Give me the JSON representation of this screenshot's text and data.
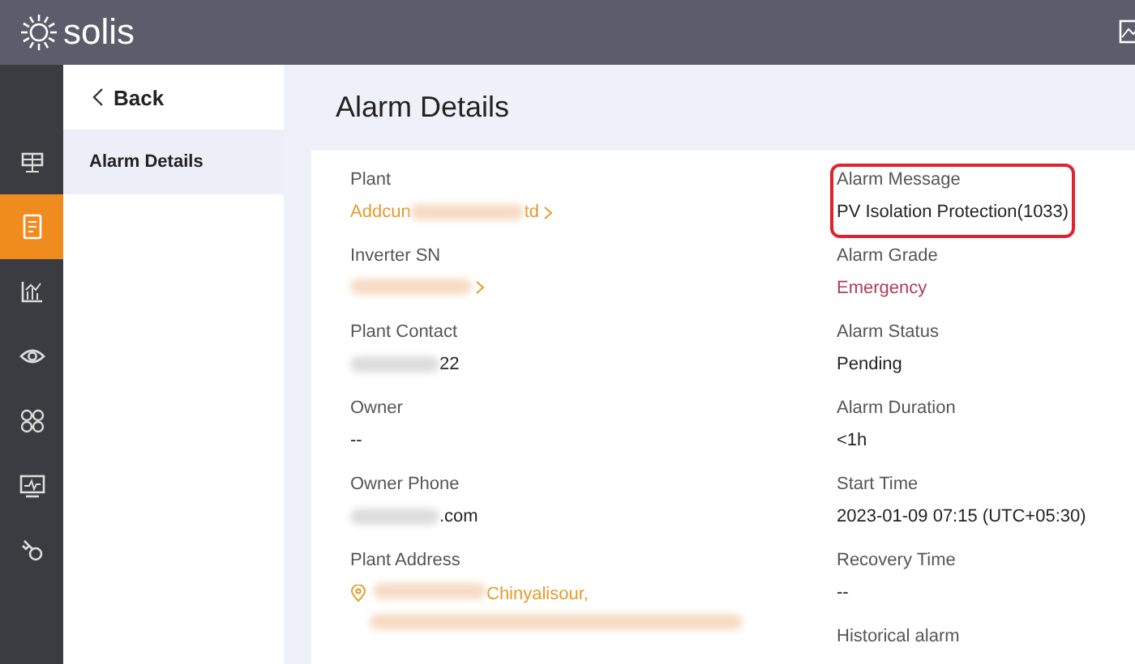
{
  "top_bar": {
    "logo": "solis"
  },
  "nav_rail": [
    {
      "selected": false
    },
    {
      "selected": true
    },
    {
      "selected": false
    },
    {
      "selected": false
    },
    {
      "selected": false
    },
    {
      "selected": false
    },
    {
      "selected": false
    }
  ],
  "submenu": {
    "back": "Back",
    "items": [
      {
        "label": "Alarm Details",
        "selected": true
      }
    ]
  },
  "page_title": "Alarm Details",
  "left_fields": [
    {
      "label": "Plant",
      "kind": "link",
      "prefix": "Addcun",
      "suffix": "td",
      "redacted": true
    },
    {
      "label": "Inverter SN",
      "kind": "link",
      "redacted": true
    },
    {
      "label": "Plant Contact",
      "kind": "text",
      "suffix": "22",
      "redacted": true
    },
    {
      "label": "Owner",
      "kind": "text",
      "prefix": "--",
      "redacted": false
    },
    {
      "label": "Owner Phone",
      "kind": "text",
      "suffix": ".com",
      "redacted": true
    },
    {
      "label": "Plant Address",
      "kind": "address",
      "suffix": "Chinyalisour,",
      "redacted": true
    }
  ],
  "right_fields": [
    {
      "label": "Alarm Message",
      "kind": "text",
      "value": "PV Isolation Protection(1033)",
      "highlighted": true
    },
    {
      "label": "Alarm Grade",
      "kind": "emergency",
      "value": "Emergency",
      "highlighted": false
    },
    {
      "label": "Alarm Status",
      "kind": "text",
      "value": "Pending",
      "highlighted": false
    },
    {
      "label": "Alarm Duration",
      "kind": "text",
      "value": "<1h",
      "highlighted": false
    },
    {
      "label": "Start Time",
      "kind": "text",
      "value": "2023-01-09 07:15 (UTC+05:30)",
      "highlighted": false
    },
    {
      "label": "Recovery Time",
      "kind": "text",
      "value": "--",
      "highlighted": false
    },
    {
      "label": "Historical alarm",
      "kind": "label_only"
    }
  ]
}
